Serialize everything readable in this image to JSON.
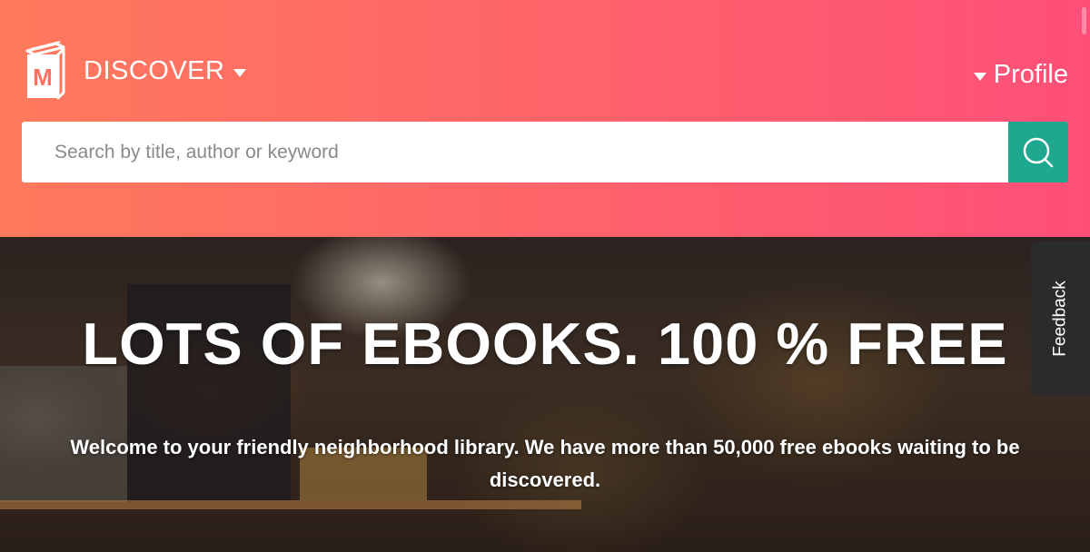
{
  "header": {
    "logo_letter": "M",
    "discover_label": "DISCOVER",
    "profile_label": "Profile"
  },
  "search": {
    "placeholder": "Search by title, author or keyword",
    "value": ""
  },
  "hero": {
    "title": "LOTS OF EBOOKS. 100 % FREE",
    "subtitle": "Welcome to your friendly neighborhood library. We have more than 50,000 free ebooks waiting to be discovered."
  },
  "feedback": {
    "label": "Feedback"
  },
  "icons": {
    "logo": "book-logo-icon",
    "discover_caret": "caret-down-icon",
    "profile_caret": "caret-down-icon",
    "search": "search-icon"
  },
  "colors": {
    "header_gradient_start": "#ff7a5c",
    "header_gradient_end": "#fe4f78",
    "search_button": "#1ea890",
    "feedback_tab": "#2b2b2b"
  }
}
